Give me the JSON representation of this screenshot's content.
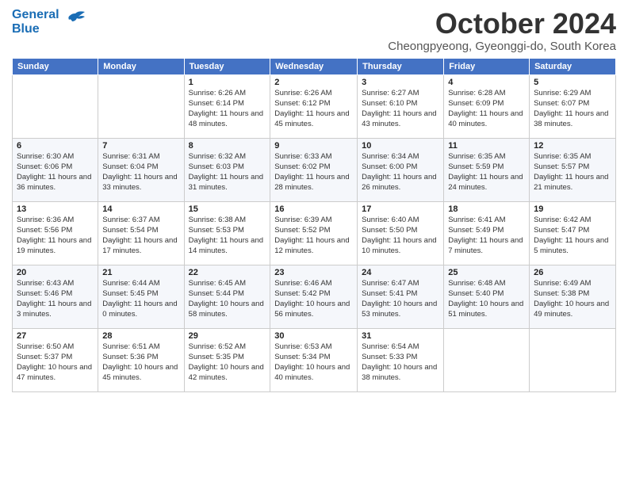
{
  "logo": {
    "line1": "General",
    "line2": "Blue"
  },
  "title": "October 2024",
  "subtitle": "Cheongpyeong, Gyeonggi-do, South Korea",
  "days_header": [
    "Sunday",
    "Monday",
    "Tuesday",
    "Wednesday",
    "Thursday",
    "Friday",
    "Saturday"
  ],
  "weeks": [
    [
      {
        "day": "",
        "info": ""
      },
      {
        "day": "",
        "info": ""
      },
      {
        "day": "1",
        "info": "Sunrise: 6:26 AM\nSunset: 6:14 PM\nDaylight: 11 hours and 48 minutes."
      },
      {
        "day": "2",
        "info": "Sunrise: 6:26 AM\nSunset: 6:12 PM\nDaylight: 11 hours and 45 minutes."
      },
      {
        "day": "3",
        "info": "Sunrise: 6:27 AM\nSunset: 6:10 PM\nDaylight: 11 hours and 43 minutes."
      },
      {
        "day": "4",
        "info": "Sunrise: 6:28 AM\nSunset: 6:09 PM\nDaylight: 11 hours and 40 minutes."
      },
      {
        "day": "5",
        "info": "Sunrise: 6:29 AM\nSunset: 6:07 PM\nDaylight: 11 hours and 38 minutes."
      }
    ],
    [
      {
        "day": "6",
        "info": "Sunrise: 6:30 AM\nSunset: 6:06 PM\nDaylight: 11 hours and 36 minutes."
      },
      {
        "day": "7",
        "info": "Sunrise: 6:31 AM\nSunset: 6:04 PM\nDaylight: 11 hours and 33 minutes."
      },
      {
        "day": "8",
        "info": "Sunrise: 6:32 AM\nSunset: 6:03 PM\nDaylight: 11 hours and 31 minutes."
      },
      {
        "day": "9",
        "info": "Sunrise: 6:33 AM\nSunset: 6:02 PM\nDaylight: 11 hours and 28 minutes."
      },
      {
        "day": "10",
        "info": "Sunrise: 6:34 AM\nSunset: 6:00 PM\nDaylight: 11 hours and 26 minutes."
      },
      {
        "day": "11",
        "info": "Sunrise: 6:35 AM\nSunset: 5:59 PM\nDaylight: 11 hours and 24 minutes."
      },
      {
        "day": "12",
        "info": "Sunrise: 6:35 AM\nSunset: 5:57 PM\nDaylight: 11 hours and 21 minutes."
      }
    ],
    [
      {
        "day": "13",
        "info": "Sunrise: 6:36 AM\nSunset: 5:56 PM\nDaylight: 11 hours and 19 minutes."
      },
      {
        "day": "14",
        "info": "Sunrise: 6:37 AM\nSunset: 5:54 PM\nDaylight: 11 hours and 17 minutes."
      },
      {
        "day": "15",
        "info": "Sunrise: 6:38 AM\nSunset: 5:53 PM\nDaylight: 11 hours and 14 minutes."
      },
      {
        "day": "16",
        "info": "Sunrise: 6:39 AM\nSunset: 5:52 PM\nDaylight: 11 hours and 12 minutes."
      },
      {
        "day": "17",
        "info": "Sunrise: 6:40 AM\nSunset: 5:50 PM\nDaylight: 11 hours and 10 minutes."
      },
      {
        "day": "18",
        "info": "Sunrise: 6:41 AM\nSunset: 5:49 PM\nDaylight: 11 hours and 7 minutes."
      },
      {
        "day": "19",
        "info": "Sunrise: 6:42 AM\nSunset: 5:47 PM\nDaylight: 11 hours and 5 minutes."
      }
    ],
    [
      {
        "day": "20",
        "info": "Sunrise: 6:43 AM\nSunset: 5:46 PM\nDaylight: 11 hours and 3 minutes."
      },
      {
        "day": "21",
        "info": "Sunrise: 6:44 AM\nSunset: 5:45 PM\nDaylight: 11 hours and 0 minutes."
      },
      {
        "day": "22",
        "info": "Sunrise: 6:45 AM\nSunset: 5:44 PM\nDaylight: 10 hours and 58 minutes."
      },
      {
        "day": "23",
        "info": "Sunrise: 6:46 AM\nSunset: 5:42 PM\nDaylight: 10 hours and 56 minutes."
      },
      {
        "day": "24",
        "info": "Sunrise: 6:47 AM\nSunset: 5:41 PM\nDaylight: 10 hours and 53 minutes."
      },
      {
        "day": "25",
        "info": "Sunrise: 6:48 AM\nSunset: 5:40 PM\nDaylight: 10 hours and 51 minutes."
      },
      {
        "day": "26",
        "info": "Sunrise: 6:49 AM\nSunset: 5:38 PM\nDaylight: 10 hours and 49 minutes."
      }
    ],
    [
      {
        "day": "27",
        "info": "Sunrise: 6:50 AM\nSunset: 5:37 PM\nDaylight: 10 hours and 47 minutes."
      },
      {
        "day": "28",
        "info": "Sunrise: 6:51 AM\nSunset: 5:36 PM\nDaylight: 10 hours and 45 minutes."
      },
      {
        "day": "29",
        "info": "Sunrise: 6:52 AM\nSunset: 5:35 PM\nDaylight: 10 hours and 42 minutes."
      },
      {
        "day": "30",
        "info": "Sunrise: 6:53 AM\nSunset: 5:34 PM\nDaylight: 10 hours and 40 minutes."
      },
      {
        "day": "31",
        "info": "Sunrise: 6:54 AM\nSunset: 5:33 PM\nDaylight: 10 hours and 38 minutes."
      },
      {
        "day": "",
        "info": ""
      },
      {
        "day": "",
        "info": ""
      }
    ]
  ]
}
